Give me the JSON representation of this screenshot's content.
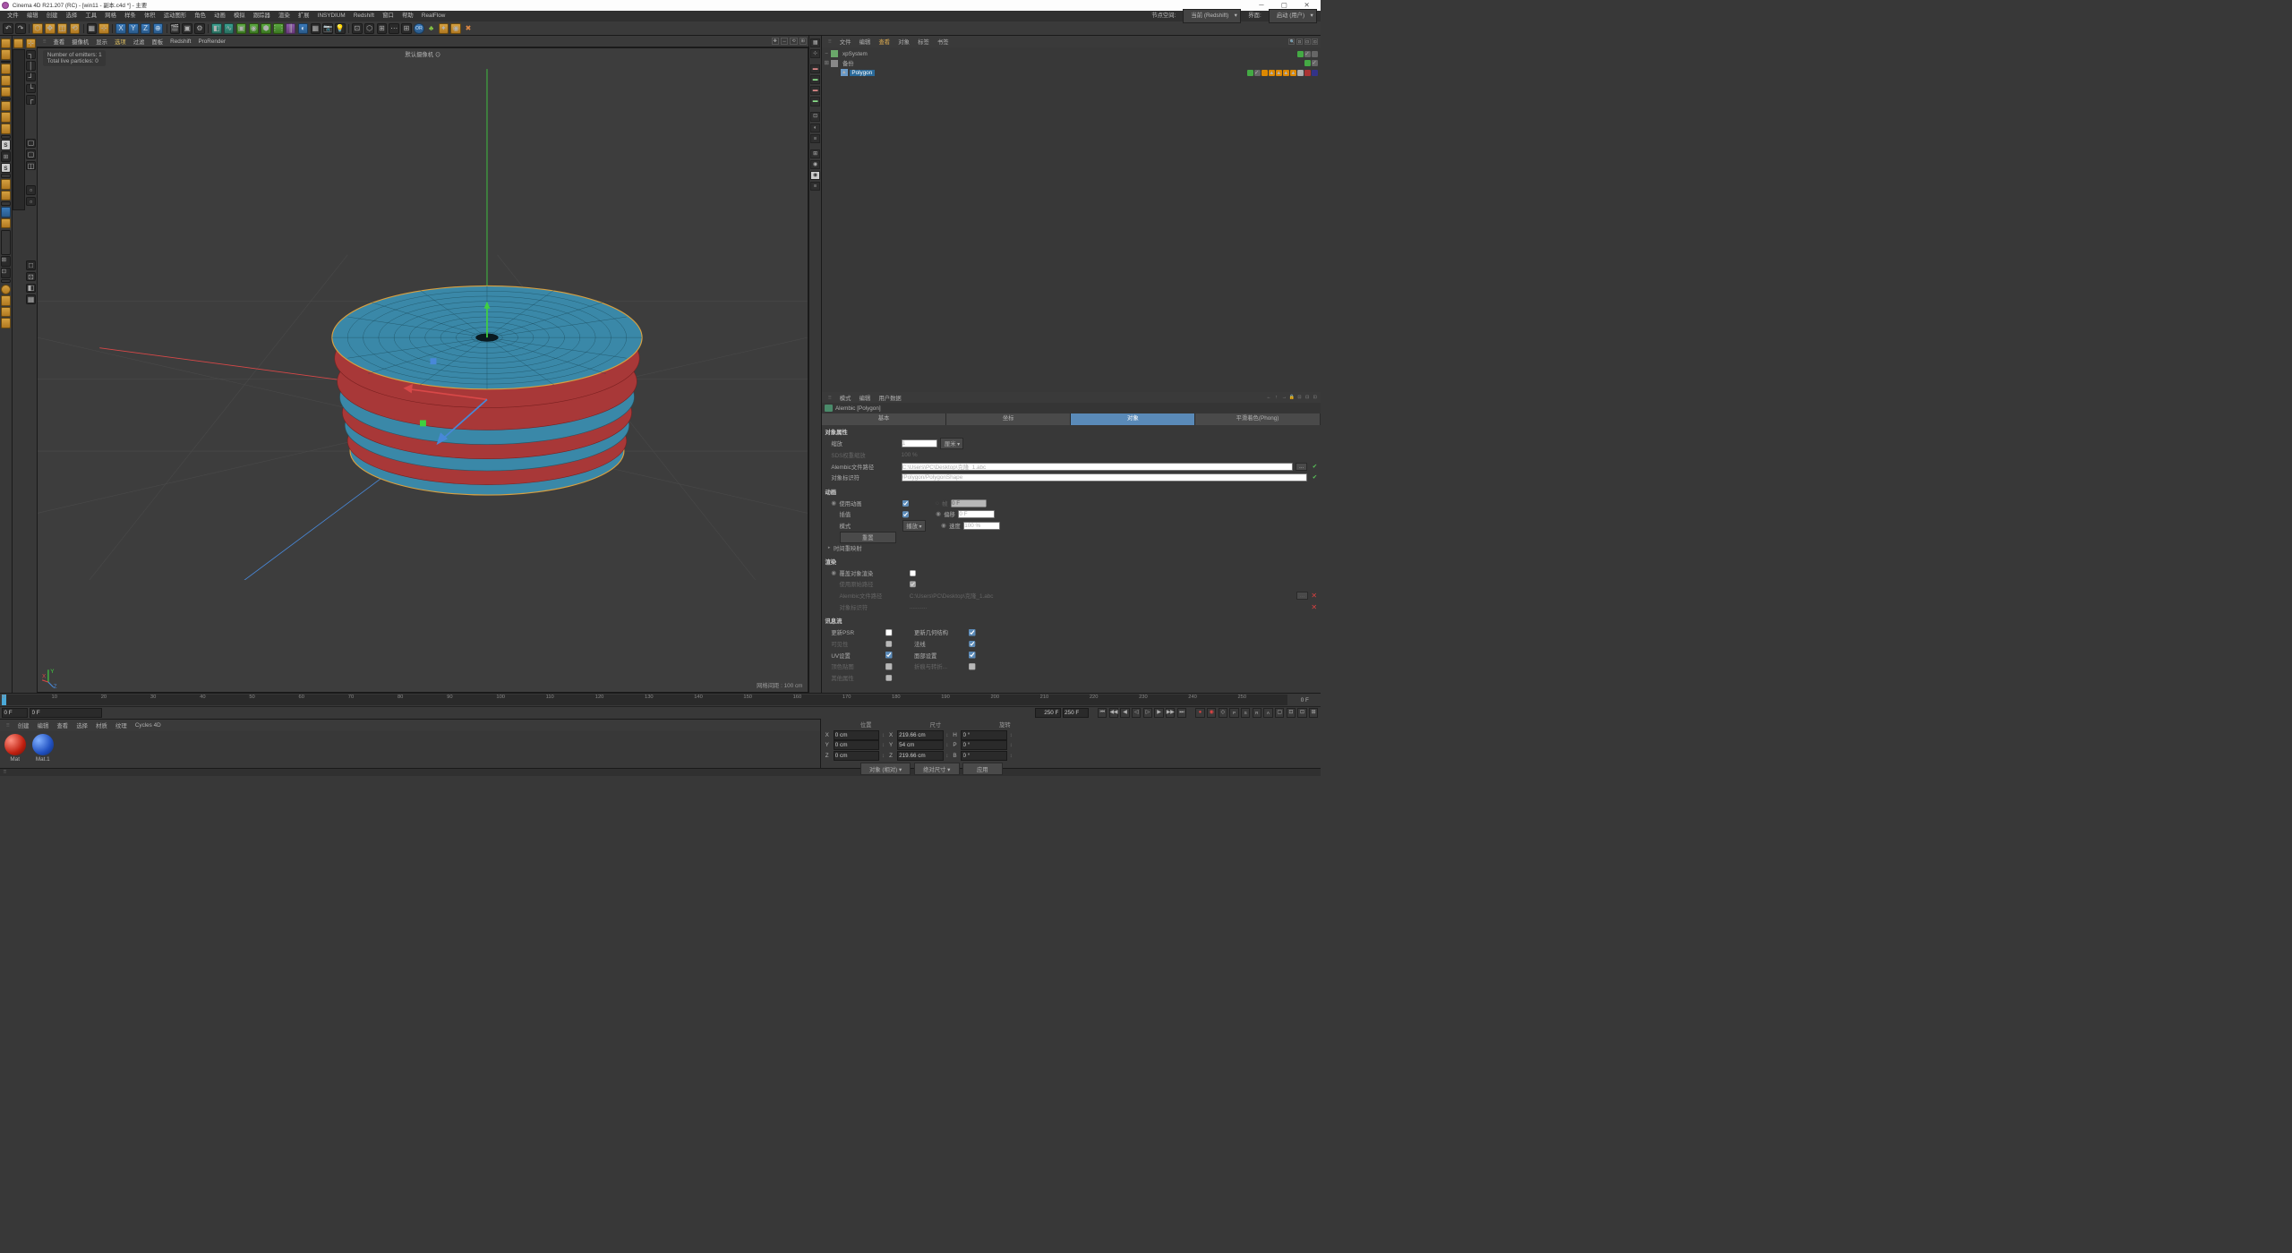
{
  "title": "Cinema 4D R21.207 (RC) - [win11 - 副本.c4d *] - 主要",
  "menu": [
    "文件",
    "编辑",
    "创建",
    "选择",
    "工具",
    "网格",
    "样条",
    "体积",
    "运动图形",
    "角色",
    "动画",
    "模拟",
    "跟踪器",
    "渲染",
    "扩展",
    "INSYDIUM",
    "Redshift",
    "窗口",
    "帮助",
    "RealFlow"
  ],
  "menu_right": {
    "label1": "节点空间:",
    "val1": "当前 (Redshift)",
    "label2": "界面:",
    "val2": "启动 (用户)"
  },
  "vp_menu": [
    "查看",
    "摄像机",
    "显示",
    "选项",
    "过滤",
    "面板",
    "Redshift",
    "ProRender"
  ],
  "vp_info": {
    "emitters": "Number of emitters: 1",
    "particles": "Total live particles: 0",
    "cam": "默认摄像机",
    "grid": "网格间距 : 100 cm"
  },
  "obj_tabs": [
    "文件",
    "编辑",
    "查看",
    "对象",
    "标签",
    "书签"
  ],
  "tree": [
    {
      "name": "xpSystem",
      "indent": 0,
      "exp": "−",
      "ico": "#6aa86a"
    },
    {
      "name": "备份",
      "indent": 0,
      "exp": "+",
      "ico": "#888"
    },
    {
      "name": "Polygon",
      "indent": 1,
      "exp": "",
      "ico": "#6a9ac8",
      "sel": true
    }
  ],
  "attr_tabs": [
    "模式",
    "编辑",
    "用户数据"
  ],
  "attr_title": "Alembic [Polygon]",
  "attr_tabrow": [
    "基本",
    "坐标",
    "对象",
    "平滑着色(Phong)"
  ],
  "obj_props": {
    "header": "对象属性",
    "scale_lbl": "缩放",
    "scale_val": "1",
    "scale_unit": "厘米",
    "sds_lbl": "SDS权重缩放",
    "sds_val": "100 %",
    "path_lbl": "Alembic文件路径",
    "path_val": "C:\\Users\\PC\\Desktop\\克隆_1.abc",
    "id_lbl": "对象标识符",
    "id_val": "/Polygon/PolygonShape"
  },
  "anim": {
    "header": "动画",
    "use_lbl": "使用动画",
    "frame_lbl": "帧",
    "frame_val": "0 F",
    "interp_lbl": "插值",
    "offset_lbl": "偏移",
    "offset_val": "0 F",
    "mode_lbl": "模式",
    "mode_val": "播放",
    "speed_lbl": "速度",
    "speed_val": "100 %",
    "reset": "重置",
    "remap": "时间重映射"
  },
  "render": {
    "header": "渲染",
    "override_lbl": "覆盖对象渲染",
    "rawpath_lbl": "使用原始路径",
    "path_lbl": "Alembic文件路径",
    "path_val": "C:\\Users\\PC\\Desktop\\克隆_1.abc",
    "id_lbl": "对象标识符",
    "id_val": "..........."
  },
  "stream": {
    "header": "讯息流",
    "psr_lbl": "更新PSR",
    "geo_lbl": "更新几何结构",
    "vis_lbl": "可见性",
    "norm_lbl": "法线",
    "uv_lbl": "UV设置",
    "face_lbl": "面部设置",
    "vcol_lbl": "顶色贴图",
    "crease_lbl": "折痕与转折...",
    "other_lbl": "其他属性"
  },
  "timeline": {
    "start": "0 F",
    "startf": "0 F",
    "end": "250 F",
    "endf": "250 F",
    "cur": "0 F"
  },
  "mat_tabs": [
    "创建",
    "编辑",
    "查看",
    "选择",
    "材质",
    "纹理",
    "Cycles 4D"
  ],
  "mats": [
    {
      "name": "Mat",
      "cls": "ball-red"
    },
    {
      "name": "Mat.1",
      "cls": "ball-blue"
    }
  ],
  "transform": {
    "headers": [
      "位置",
      "尺寸",
      "旋转"
    ],
    "rows": [
      {
        "ax": "X",
        "p": "0 cm",
        "s": "219.66 cm",
        "rl": "H",
        "r": "0 °"
      },
      {
        "ax": "Y",
        "p": "0 cm",
        "s": "54 cm",
        "rl": "P",
        "r": "0 °"
      },
      {
        "ax": "Z",
        "p": "0 cm",
        "s": "219.66 cm",
        "rl": "B",
        "r": "0 °"
      }
    ],
    "dd1": "对象 (相对)",
    "dd2": "绝对尺寸",
    "apply": "应用"
  }
}
